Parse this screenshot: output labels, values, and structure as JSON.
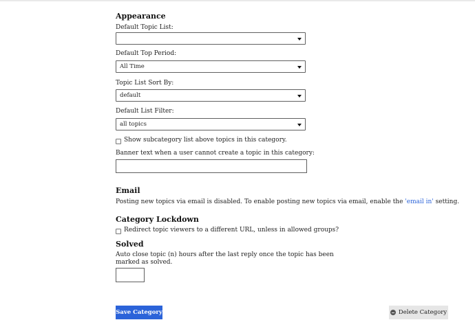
{
  "appearance": {
    "heading": "Appearance",
    "default_topic_list": {
      "label": "Default Topic List:",
      "value": ""
    },
    "default_top_period": {
      "label": "Default Top Period:",
      "value": "All Time"
    },
    "topic_list_sort_by": {
      "label": "Topic List Sort By:",
      "value": "default"
    },
    "default_list_filter": {
      "label": "Default List Filter:",
      "value": "all topics"
    },
    "show_subcategory_label": "Show subcategory list above topics in this category.",
    "show_subcategory_checked": false,
    "banner_text_label": "Banner text when a user cannot create a topic in this category:",
    "banner_text_value": ""
  },
  "email": {
    "heading": "Email",
    "text_before": "Posting new topics via email is disabled. To enable posting new topics via email, enable the ",
    "link_text": "'email in'",
    "text_after": " setting."
  },
  "lockdown": {
    "heading": "Category Lockdown",
    "redirect_label": "Redirect topic viewers to a different URL, unless in allowed groups?",
    "redirect_checked": false
  },
  "solved": {
    "heading": "Solved",
    "auto_close_line1": "Auto close topic (n) hours after the last reply once the topic has been",
    "auto_close_line2": "marked as solved.",
    "hours_value": ""
  },
  "actions": {
    "save_label": "Save Category",
    "delete_label": "Delete Category",
    "delete_icon": "minus-circle-icon"
  },
  "colors": {
    "primary": "#2b63d9",
    "delete_bg": "#e6e6e6",
    "border": "#5f5f5f"
  }
}
